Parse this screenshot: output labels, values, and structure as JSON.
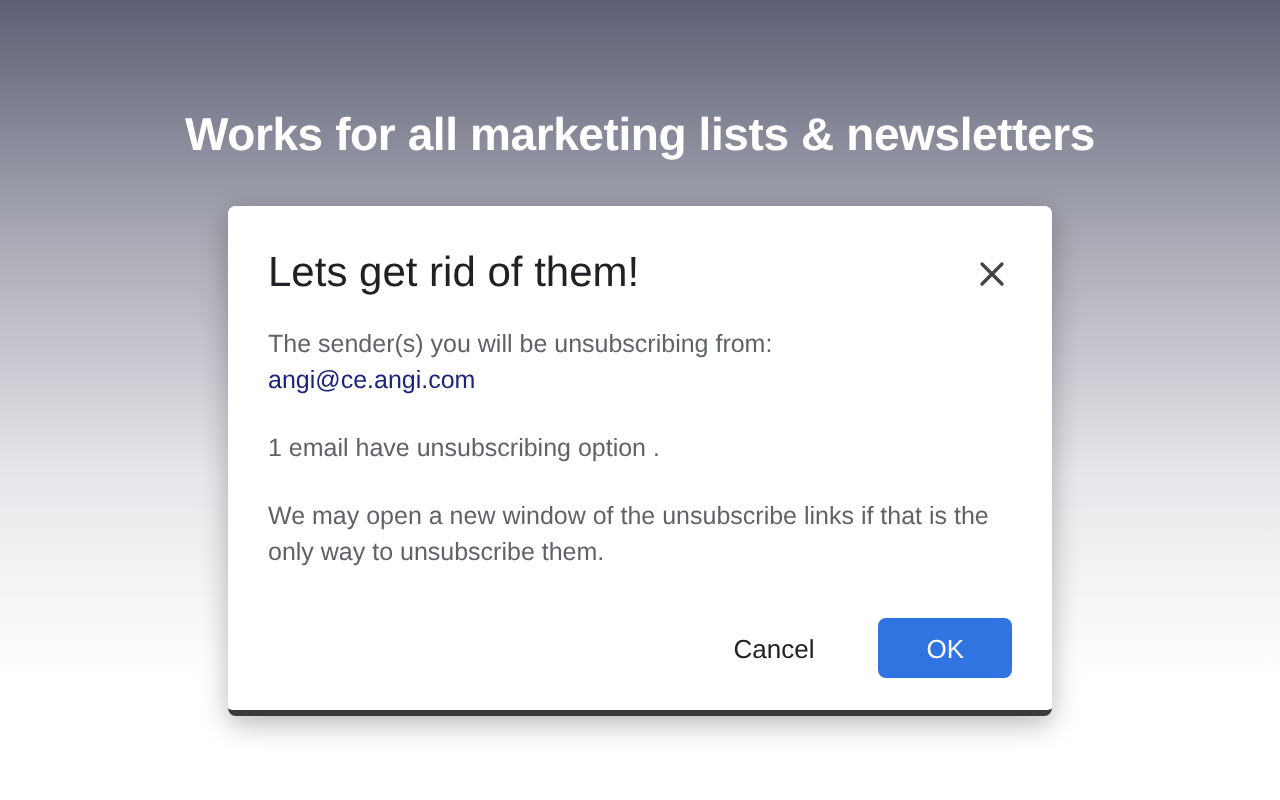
{
  "headline": "Works for all marketing lists & newsletters",
  "dialog": {
    "title": "Lets get rid of them!",
    "intro": "The sender(s) you will be unsubscribing from:",
    "senders": [
      "angi@ce.angi.com"
    ],
    "count_note": "1 email have unsubscribing option .",
    "notice": "We may open a new window of the unsubscribe links if that is the only way to unsubscribe them.",
    "buttons": [
      {
        "label": "Cancel",
        "kind": "text"
      },
      {
        "label": "OK",
        "kind": "primary"
      }
    ]
  }
}
